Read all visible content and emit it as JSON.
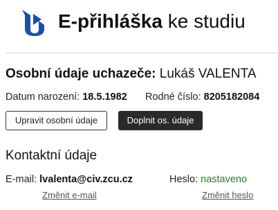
{
  "header": {
    "title_bold": "E-přihláška",
    "title_rest": " ke studiu",
    "logo_color": "#1f4fa3"
  },
  "personal": {
    "title_bold": "Osobní údaje uchazeče:",
    "name": " Lukáš VALENTA",
    "birth_label": "Datum narození:",
    "birth_value": "18.5.1982",
    "id_label": "Rodné číslo:",
    "id_value": "8205182084",
    "edit_button": "Upravit osobní údaje",
    "complete_button": "Doplnit os. údaje"
  },
  "contact": {
    "title": "Kontaktní údaje",
    "email_label": "E-mail:",
    "email_value": "lvalenta@civ.zcu.cz",
    "password_label": "Heslo:",
    "password_value": "nastaveno",
    "change_email": "Změnit e-mail",
    "change_password": "Změnit heslo"
  },
  "colors": {
    "accent_green": "#2c7a2c",
    "dark_button": "#2a2a2a"
  }
}
